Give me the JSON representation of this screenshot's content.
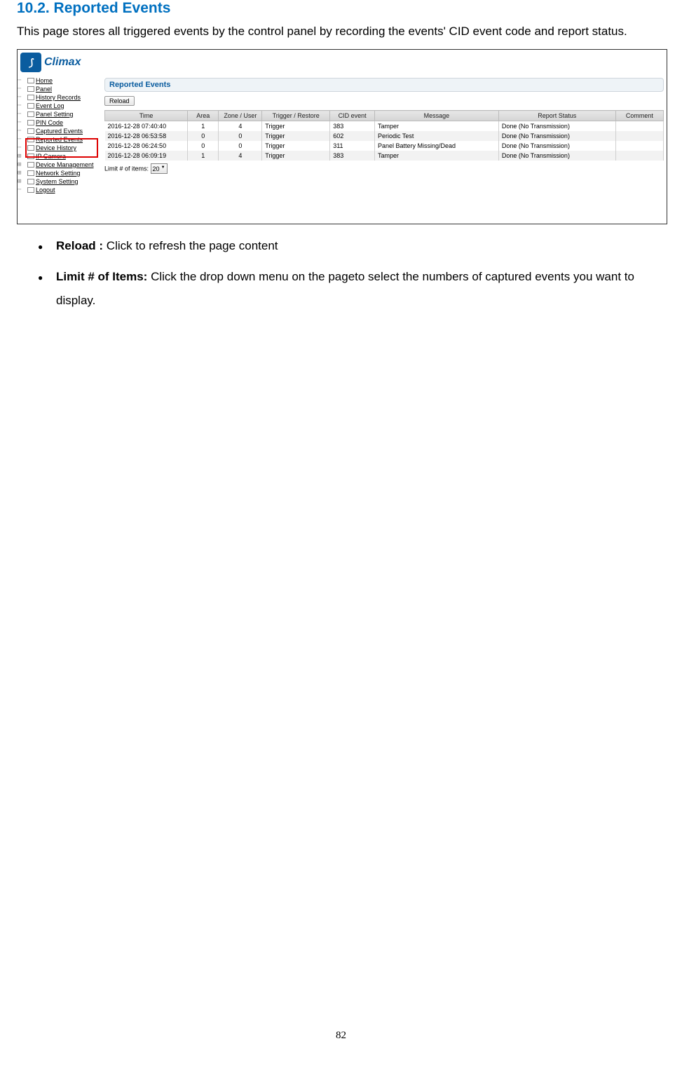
{
  "heading": "10.2. Reported Events",
  "intro": "This page stores all triggered events by the control panel by recording the events' CID event code and report status.",
  "logo": {
    "name": "Climax"
  },
  "sidebar": {
    "items": [
      {
        "label": "Home",
        "kind": "dash"
      },
      {
        "label": "Panel",
        "kind": "dash"
      },
      {
        "label": "History Records",
        "kind": "dash"
      },
      {
        "label": "Event Log",
        "kind": "dash"
      },
      {
        "label": "Panel Setting",
        "kind": "dash"
      },
      {
        "label": "PIN Code",
        "kind": "dash"
      },
      {
        "label": "Captured Events",
        "kind": "dash"
      },
      {
        "label": "Reported Events",
        "kind": "dash",
        "selected": true
      },
      {
        "label": "Device History",
        "kind": "dash"
      },
      {
        "label": "IP Camera",
        "kind": "plus"
      },
      {
        "label": "Device Management",
        "kind": "plus"
      },
      {
        "label": "Network Setting",
        "kind": "plus"
      },
      {
        "label": "System Setting",
        "kind": "plus"
      },
      {
        "label": "Logout",
        "kind": "dash"
      }
    ]
  },
  "content": {
    "title": "Reported Events",
    "reload_label": "Reload",
    "headers": {
      "time": "Time",
      "area": "Area",
      "zone": "Zone / User",
      "trigger": "Trigger / Restore",
      "cid": "CID event",
      "message": "Message",
      "status": "Report Status",
      "comment": "Comment"
    },
    "rows": [
      {
        "time": "2016-12-28 07:40:40",
        "area": "1",
        "zone": "4",
        "trigger": "Trigger",
        "cid": "383",
        "message": "Tamper",
        "status": "Done (No Transmission)",
        "comment": ""
      },
      {
        "time": "2016-12-28 06:53:58",
        "area": "0",
        "zone": "0",
        "trigger": "Trigger",
        "cid": "602",
        "message": "Periodic Test",
        "status": "Done (No Transmission)",
        "comment": ""
      },
      {
        "time": "2016-12-28 06:24:50",
        "area": "0",
        "zone": "0",
        "trigger": "Trigger",
        "cid": "311",
        "message": "Panel Battery Missing/Dead",
        "status": "Done (No Transmission)",
        "comment": ""
      },
      {
        "time": "2016-12-28 06:09:19",
        "area": "1",
        "zone": "4",
        "trigger": "Trigger",
        "cid": "383",
        "message": "Tamper",
        "status": "Done (No Transmission)",
        "comment": ""
      }
    ],
    "limit_label": "Limit # of items:",
    "limit_value": "20"
  },
  "bullets": [
    {
      "title": "Reload :",
      "text": " Click to refresh the page content"
    },
    {
      "title": "Limit # of Items:",
      "text": " Click the drop down menu on the pageto select the numbers of captured events you want to display."
    }
  ],
  "page_number": "82"
}
